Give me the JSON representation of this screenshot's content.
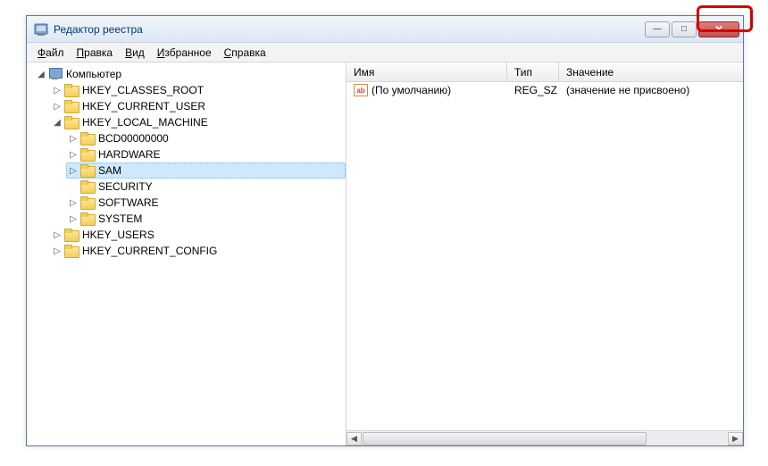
{
  "window": {
    "title": "Редактор реестра",
    "buttons": {
      "min": "—",
      "max": "□",
      "close": "✕"
    }
  },
  "menu": {
    "file": {
      "u": "Ф",
      "rest": "айл"
    },
    "edit": {
      "u": "П",
      "rest": "равка"
    },
    "view": {
      "u": "В",
      "rest": "ид"
    },
    "fav": {
      "u": "И",
      "rest": "збранное"
    },
    "help": {
      "u": "С",
      "rest": "правка"
    }
  },
  "tree": {
    "root": "Компьютер",
    "hkcr": "HKEY_CLASSES_ROOT",
    "hkcu": "HKEY_CURRENT_USER",
    "hklm": "HKEY_LOCAL_MACHINE",
    "hklm_children": {
      "bcd": "BCD00000000",
      "hw": "HARDWARE",
      "sam": "SAM",
      "sec": "SECURITY",
      "sw": "SOFTWARE",
      "sys": "SYSTEM"
    },
    "hku": "HKEY_USERS",
    "hkcc": "HKEY_CURRENT_CONFIG"
  },
  "columns": {
    "name": "Имя",
    "type": "Тип",
    "value": "Значение"
  },
  "rows": [
    {
      "name": "(По умолчанию)",
      "type": "REG_SZ",
      "value": "(значение не присвоено)"
    }
  ],
  "glyphs": {
    "expand_open": "◢",
    "expand_closed": "▷",
    "scroll_left": "◀",
    "scroll_right": "▶",
    "sz_icon": "ab"
  }
}
